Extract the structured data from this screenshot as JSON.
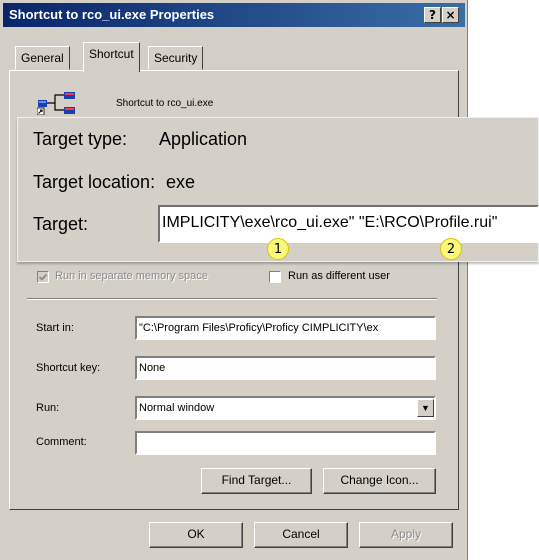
{
  "window": {
    "title": "Shortcut to rco_ui.exe Properties",
    "help_button": "?",
    "close_button": "×"
  },
  "tabs": [
    {
      "label": "General"
    },
    {
      "label": "Shortcut"
    },
    {
      "label": "Security"
    }
  ],
  "shortcut": {
    "icon": "application-shortcut-icon",
    "name": "Shortcut to rco_ui.exe"
  },
  "callout": {
    "target_type_label": "Target type:",
    "target_type_value": "Application",
    "target_location_label": "Target location:",
    "target_location_value": "exe",
    "target_label": "Target:",
    "target_value": "IMPLICITY\\exe\\rco_ui.exe\" \"E:\\RCO\\Profile.rui\""
  },
  "badges": [
    "1",
    "2"
  ],
  "options": {
    "separate_memory_label": "Run in separate memory space",
    "separate_memory_checked": true,
    "different_user_label": "Run as different user",
    "different_user_checked": false
  },
  "fields": {
    "start_in_label": "Start in:",
    "start_in_value": "\"C:\\Program Files\\Proficy\\Proficy CIMPLICITY\\ex",
    "shortcut_key_label": "Shortcut key:",
    "shortcut_key_value": "None",
    "run_label": "Run:",
    "run_value": "Normal window",
    "comment_label": "Comment:",
    "comment_value": ""
  },
  "buttons": {
    "find_target": "Find Target...",
    "change_icon": "Change Icon...",
    "ok": "OK",
    "cancel": "Cancel",
    "apply": "Apply"
  },
  "colors": {
    "titlebar_start": "#0a246a",
    "titlebar_end": "#3a6ea5",
    "dialog_face": "#d4d0c8",
    "badge_fill": "#fbf77a"
  }
}
